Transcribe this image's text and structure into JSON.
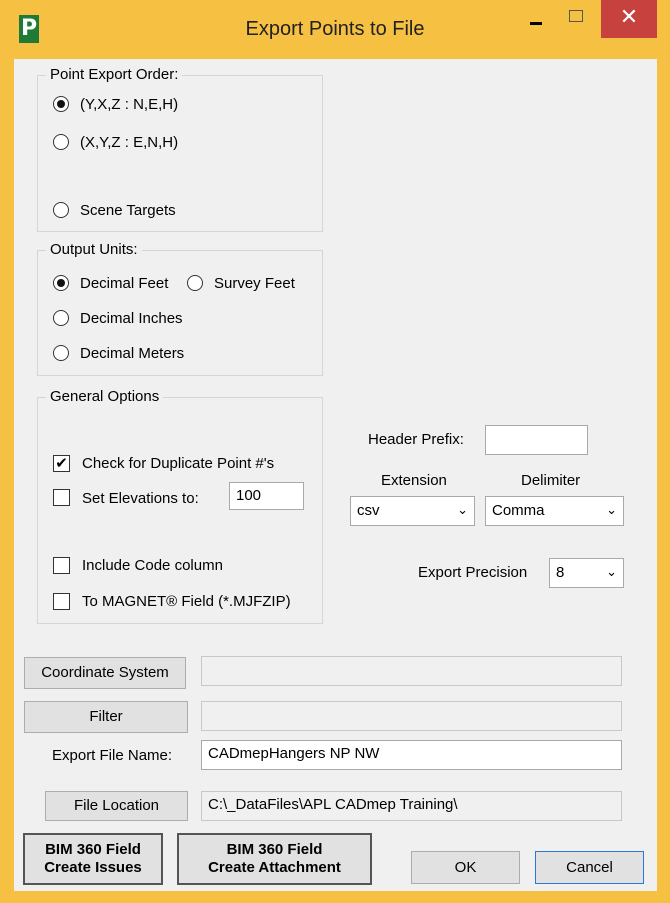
{
  "window": {
    "title": "Export Points to File",
    "app_icon": "P",
    "minimize": "–",
    "maximize": "□",
    "close": "✕"
  },
  "order": {
    "title": "Point Export Order:",
    "opt1": "(Y,X,Z  :  N,E,H)",
    "opt2": "(X,Y,Z  :  E,N,H)",
    "opt3": "Scene Targets"
  },
  "units": {
    "title": "Output Units:",
    "ft": "Decimal Feet",
    "sft": "Survey Feet",
    "in": "Decimal Inches",
    "m": "Decimal Meters"
  },
  "general": {
    "title": "General Options",
    "dup": "Check for Duplicate Point #'s",
    "elev": "Set Elevations to:",
    "elev_value": "100",
    "code": "Include Code column",
    "magnet": "To MAGNET® Field (*.MJFZIP)"
  },
  "right": {
    "header_prefix": "Header Prefix:",
    "header_prefix_value": "",
    "extension_label": "Extension",
    "extension_value": "csv",
    "delimiter_label": "Delimiter",
    "delimiter_value": "Comma",
    "precision_label": "Export Precision",
    "precision_value": "8"
  },
  "bottom": {
    "coord_btn": "Coordinate System",
    "coord_value": "",
    "filter_btn": "Filter",
    "filter_value": "",
    "filename_label": "Export File Name:",
    "filename_value": "CADmepHangers NP NW",
    "location_btn": "File Location",
    "location_value": "C:\\_DataFiles\\APL CADmep Training\\"
  },
  "actions": {
    "bim_issues_1": "BIM 360 Field",
    "bim_issues_2": "Create Issues",
    "bim_attach_1": "BIM 360 Field",
    "bim_attach_2": "Create Attachment",
    "ok": "OK",
    "cancel": "Cancel"
  },
  "icons": {
    "check": "check-icon",
    "chevron": "chevron-down-icon"
  },
  "colors": {
    "titlebar": "#f6c043",
    "close": "#c7423f",
    "accent": "#2b78d8"
  }
}
